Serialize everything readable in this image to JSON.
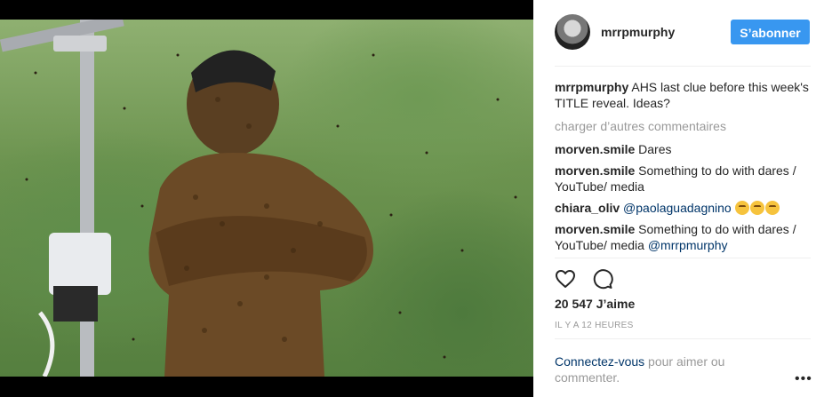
{
  "post": {
    "username": "mrrpmurphy",
    "follow_label": "S’abonner",
    "caption_user": "mrrpmurphy",
    "caption_text": "AHS last clue before this week's TITLE reveal. Ideas?",
    "load_more": "charger d’autres commentaires",
    "comments": [
      {
        "user": "morven.smile",
        "text": "Dares"
      },
      {
        "user": "morven.smile",
        "text": "Something to do with dares / YouTube/ media"
      },
      {
        "user": "chiara_oliv",
        "mention": "@paolaguadagnino",
        "emoji": "thinking-face-emoji"
      },
      {
        "user": "morven.smile",
        "text": "Something to do with dares / YouTube/ media",
        "mention": "@mrrpmurphy"
      }
    ],
    "likes": "20 547 J’aime",
    "time": "IL Y A 12 HEURES",
    "login_link": "Connectez-vous",
    "login_rest": " pour aimer ou commenter.",
    "more_icon": "more-options-icon",
    "actions": [
      "heart-icon",
      "comment-icon"
    ]
  },
  "colors": {
    "follow_bg": "#3897f0",
    "link": "#003569",
    "muted": "#999999"
  }
}
